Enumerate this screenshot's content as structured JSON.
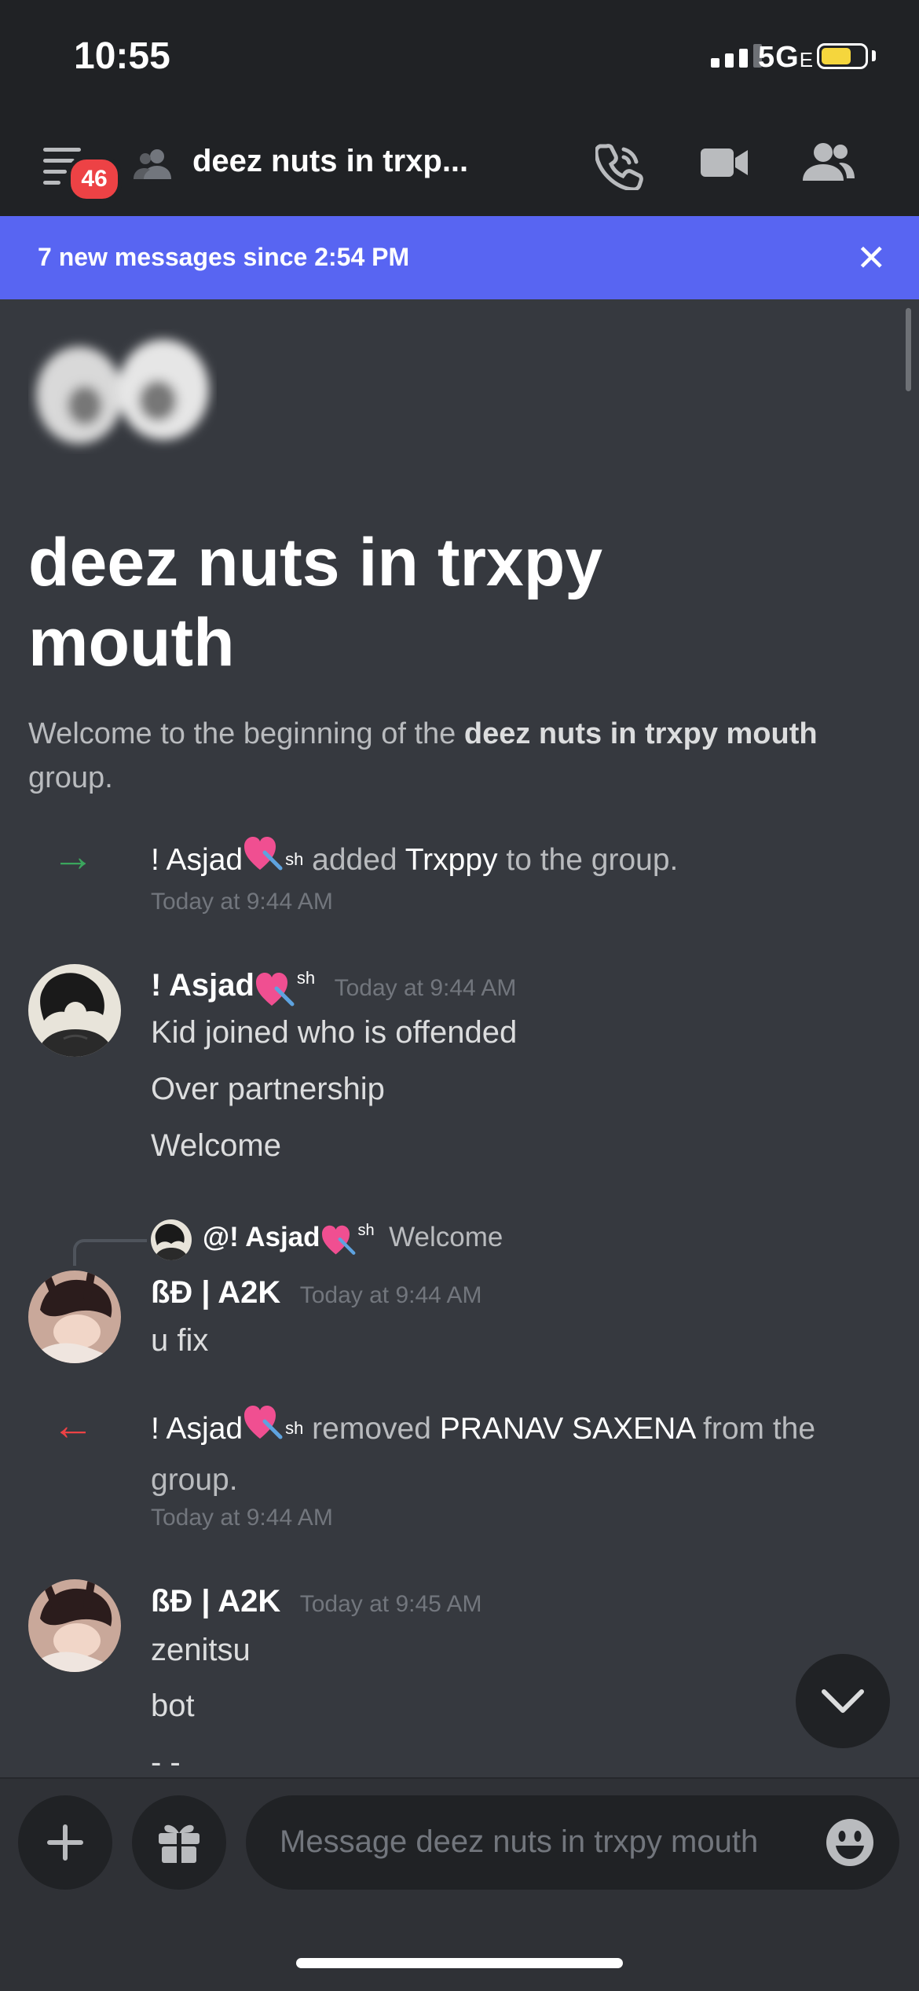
{
  "status_bar": {
    "time": "10:55",
    "network": "5G",
    "network_suffix": "E"
  },
  "header": {
    "unread_count": "46",
    "channel_title": "deez nuts in trxp..."
  },
  "banner": {
    "text": "7 new messages since 2:54 PM",
    "close": "✕"
  },
  "intro": {
    "group_name": "deez nuts in trxpy mouth",
    "welcome_prefix": "Welcome to the beginning of the ",
    "welcome_group": "deez nuts in trxpy mouth",
    "welcome_suffix": " group."
  },
  "messages": [
    {
      "type": "system-add",
      "actor": "! Asjad",
      "actor_suffix": "sh",
      "verb": "added",
      "target": "Trxppy",
      "tail": "to the group.",
      "timestamp": "Today at 9:44 AM"
    },
    {
      "type": "message",
      "author": "! Asjad",
      "author_suffix": "sh",
      "timestamp": "Today at 9:44 AM",
      "lines": [
        "Kid joined who is offended",
        "Over partnership",
        "Welcome"
      ]
    },
    {
      "type": "reply",
      "reply_to": "@! Asjad",
      "reply_suffix": "sh",
      "reply_text": "Welcome",
      "author": "ßĐ | A2K",
      "timestamp": "Today at 9:44 AM",
      "lines": [
        "u fix"
      ]
    },
    {
      "type": "system-remove",
      "actor": "! Asjad",
      "actor_suffix": "sh",
      "verb": "removed",
      "target": "PRANAV SAXENA",
      "tail": "from the",
      "tail2": "group.",
      "timestamp": "Today at 9:44 AM"
    },
    {
      "type": "message",
      "author": "ßĐ | A2K",
      "timestamp": "Today at 9:45 AM",
      "lines": [
        "zenitsu",
        "bot",
        "- -"
      ]
    }
  ],
  "composer": {
    "placeholder": "Message deez nuts in trxpy mouth"
  },
  "colors": {
    "accent": "#5865f2",
    "unread_badge": "#ed4245",
    "join_arrow": "#3ba55d",
    "leave_arrow": "#ed4245"
  }
}
